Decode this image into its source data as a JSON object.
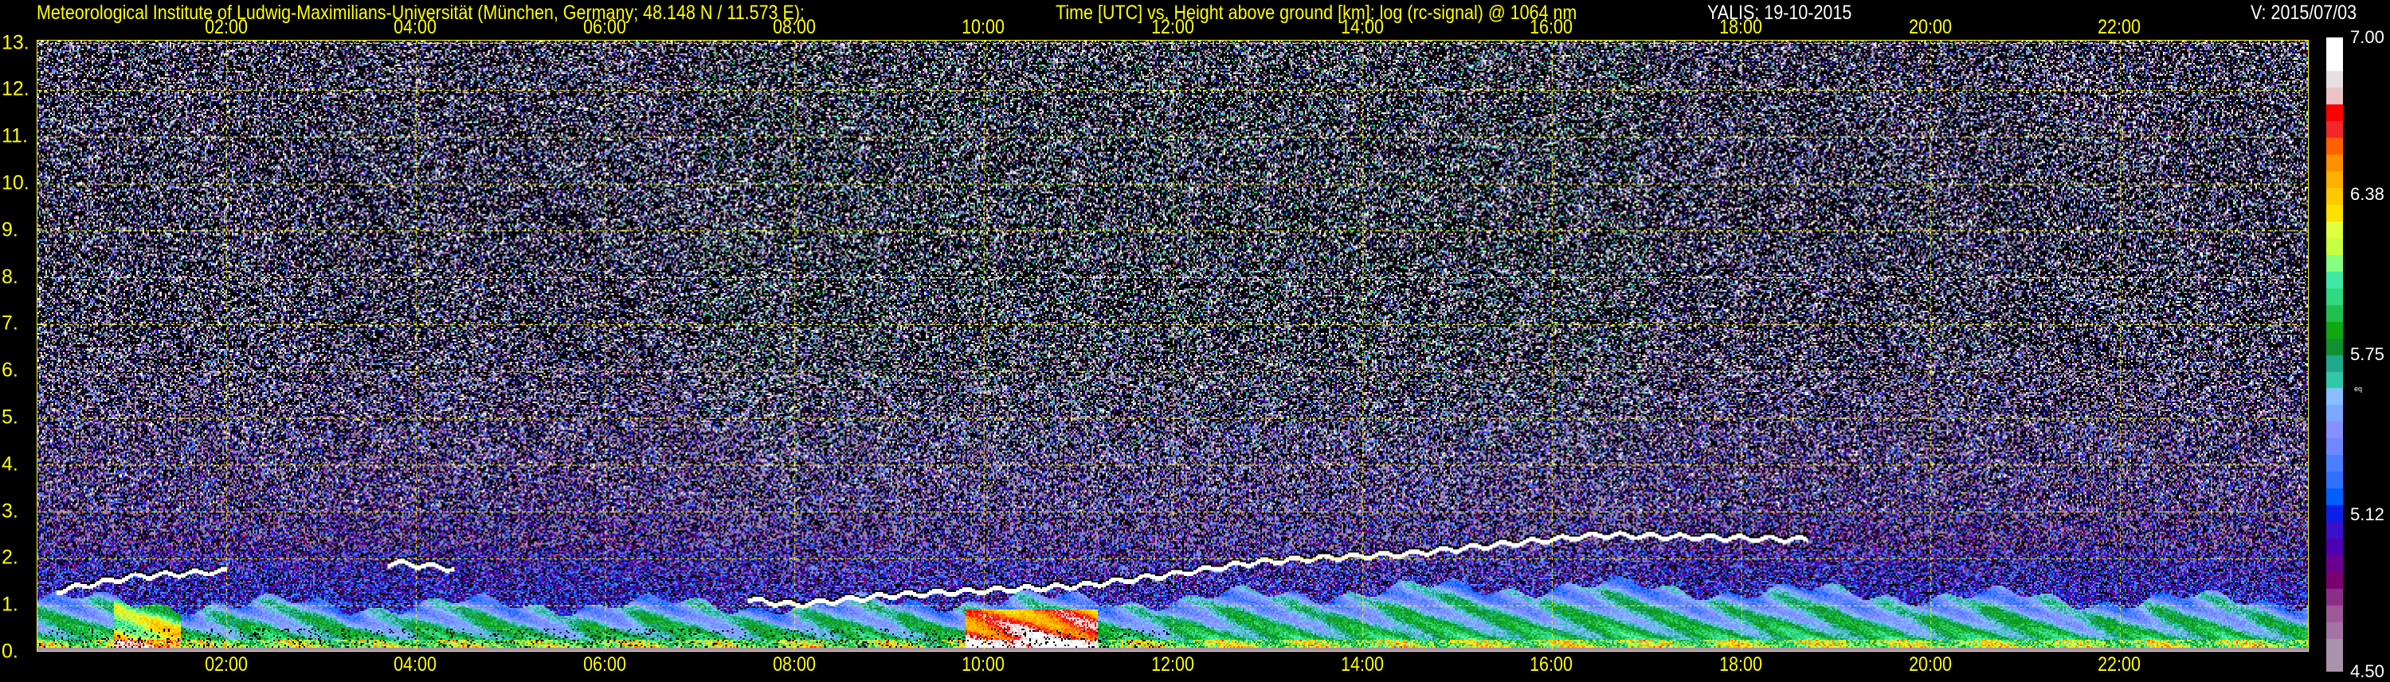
{
  "header": {
    "institute": "Meteorological Institute of Ludwig-Maximilians-Universität (München, Germany; 48.148 N / 11.573 E):",
    "plot_title": "Time [UTC] vs. Height above ground [km]: log (rc-signal) @ 1064 nm",
    "instrument_date": "YALIS: 19-10-2015",
    "version": "V: 2015/07/03"
  },
  "chart_data": {
    "type": "heatmap",
    "title": "Time [UTC] vs. Height above ground [km]: log (rc-signal) @ 1064 nm",
    "xlabel": "Time [UTC]",
    "ylabel": "Height above ground [km]",
    "xlim_hours": [
      0,
      24
    ],
    "ylim_km": [
      0,
      13.06
    ],
    "x_ticks": [
      "02:00",
      "04:00",
      "06:00",
      "08:00",
      "10:00",
      "12:00",
      "14:00",
      "16:00",
      "18:00",
      "20:00",
      "22:00"
    ],
    "x_tick_hours": [
      2,
      4,
      6,
      8,
      10,
      12,
      14,
      16,
      18,
      20,
      22
    ],
    "y_ticks": [
      "0.",
      "1.",
      "2.",
      "3.",
      "4.",
      "5.",
      "6.",
      "7.",
      "8.",
      "9.",
      "10.",
      "11.",
      "12.",
      "13."
    ],
    "y_tick_values": [
      0,
      1,
      2,
      3,
      4,
      5,
      6,
      7,
      8,
      9,
      10,
      11,
      12,
      13
    ],
    "grid": true,
    "colorbar": {
      "range": [
        4.5,
        7.0
      ],
      "ticks": [
        "7.00",
        "6.38",
        "5.75",
        "5.12",
        "4.50"
      ],
      "tick_values": [
        7.0,
        6.38,
        5.75,
        5.12,
        4.5
      ],
      "note": "eq",
      "colors": [
        "#a893ab",
        "#a893ab",
        "#a274a1",
        "#9b5a97",
        "#8b2e88",
        "#7a0070",
        "#6a0092",
        "#4c00b0",
        "#3a10c8",
        "#0a20e8",
        "#0060ff",
        "#3070ff",
        "#4a80ff",
        "#6f88ff",
        "#8890ff",
        "#7ca8ff",
        "#88c0ff",
        "#30c8a8",
        "#20a88c",
        "#109030",
        "#10a810",
        "#20c050",
        "#30d880",
        "#40e8a8",
        "#88ff80",
        "#c8ff40",
        "#e0ff40",
        "#ffe000",
        "#ffc800",
        "#ffb000",
        "#ff9000",
        "#ff6000",
        "#f02828",
        "#ff0000",
        "#ecc4c6",
        "#e8e0e0",
        "#ffffff",
        "#ffffff"
      ]
    },
    "cloud_layer_top_km": {
      "hours": [
        0.2,
        1.0,
        1.8,
        3.8,
        4.3,
        8.0,
        9.0,
        10.0,
        11.0,
        11.8,
        12.8,
        13.5,
        14.5,
        15.5,
        16.5,
        17.5,
        18.7
      ],
      "values": [
        1.3,
        1.6,
        1.7,
        1.9,
        1.8,
        1.0,
        1.2,
        1.3,
        1.4,
        1.6,
        1.9,
        2.0,
        2.1,
        2.3,
        2.5,
        2.45,
        2.4
      ]
    },
    "boundary_layer_top_km": {
      "hours": [
        0,
        2,
        4,
        6,
        8,
        10,
        12,
        14,
        16,
        18,
        20,
        22,
        24
      ],
      "values": [
        1.1,
        1.0,
        1.0,
        1.0,
        1.0,
        1.1,
        1.1,
        1.3,
        1.4,
        1.3,
        1.2,
        1.1,
        1.1
      ]
    }
  }
}
